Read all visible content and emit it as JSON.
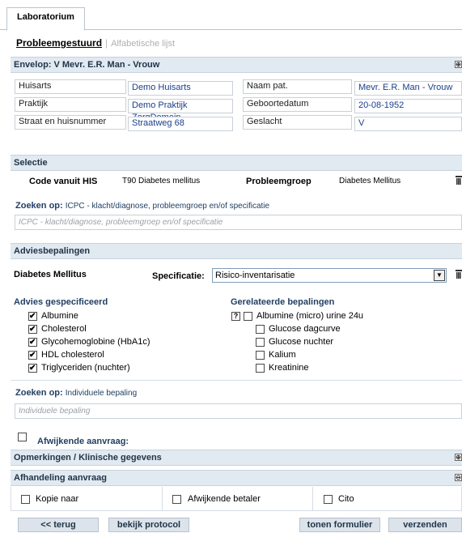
{
  "tab": {
    "label": "Laboratorium"
  },
  "subnav": {
    "active": "Probleemgestuurd",
    "separator": "|",
    "inactive": "Alfabetische lijst"
  },
  "envelop": {
    "title": "Envelop: V Mevr. E.R. Man - Vrouw",
    "toggle": "⊕",
    "rows": [
      {
        "label": "Huisarts",
        "value": "Demo Huisarts",
        "label2": "Naam pat.",
        "value2": "Mevr. E.R. Man - Vrouw"
      },
      {
        "label": "Praktijk",
        "value": "Demo Praktijk ZorgDomein",
        "label2": "Geboortedatum",
        "value2": "20-08-1952"
      },
      {
        "label": "Straat en huisnummer",
        "value": "Straatweg 68",
        "label2": "Geslacht",
        "value2": "V"
      }
    ]
  },
  "selectie": {
    "title": "Selectie",
    "code_label": "Code vanuit HIS",
    "code_value": "T90 Diabetes mellitus",
    "group_label": "Probleemgroep",
    "group_value": "Diabetes Mellitus",
    "search_label": "Zoeken op:",
    "search_hint": "ICPC - klacht/diagnose, probleemgroep en/of specificatie",
    "search_placeholder": "ICPC - klacht/diagnose, probleemgroep en/of specificatie"
  },
  "advies": {
    "title": "Adviesbepalingen",
    "group": "Diabetes Mellitus",
    "spec_label": "Specificatie:",
    "spec_value": "Risico-inventarisatie",
    "left_title": "Advies gespecificeerd",
    "right_title": "Gerelateerde bepalingen",
    "help_glyph": "?",
    "left_items": [
      {
        "label": "Albumine",
        "checked": true
      },
      {
        "label": "Cholesterol",
        "checked": true
      },
      {
        "label": "Glycohemoglobine (HbA1c)",
        "checked": true
      },
      {
        "label": "HDL cholesterol",
        "checked": true
      },
      {
        "label": "Triglyceriden (nuchter)",
        "checked": true
      }
    ],
    "right_items": [
      {
        "label": "Albumine (micro) urine 24u",
        "checked": false
      },
      {
        "label": "Glucose dagcurve",
        "checked": false
      },
      {
        "label": "Glucose nuchter",
        "checked": false
      },
      {
        "label": "Kalium",
        "checked": false
      },
      {
        "label": "Kreatinine",
        "checked": false
      }
    ],
    "search_label": "Zoeken op:",
    "search_hint": "Individuele bepaling",
    "search_placeholder": "Individuele bepaling",
    "afwijkend_label": "Afwijkende aanvraag:"
  },
  "opmerkingen": {
    "title": "Opmerkingen / Klinische gegevens",
    "toggle": "⊕"
  },
  "afhandeling": {
    "title": "Afhandeling aanvraag",
    "toggle": "⊖",
    "options": [
      "Kopie naar",
      "Afwijkende betaler",
      "Cito"
    ]
  },
  "buttons": {
    "back": "<< terug",
    "protocol": "bekijk protocol",
    "form": "tonen formulier",
    "send": "verzenden"
  }
}
